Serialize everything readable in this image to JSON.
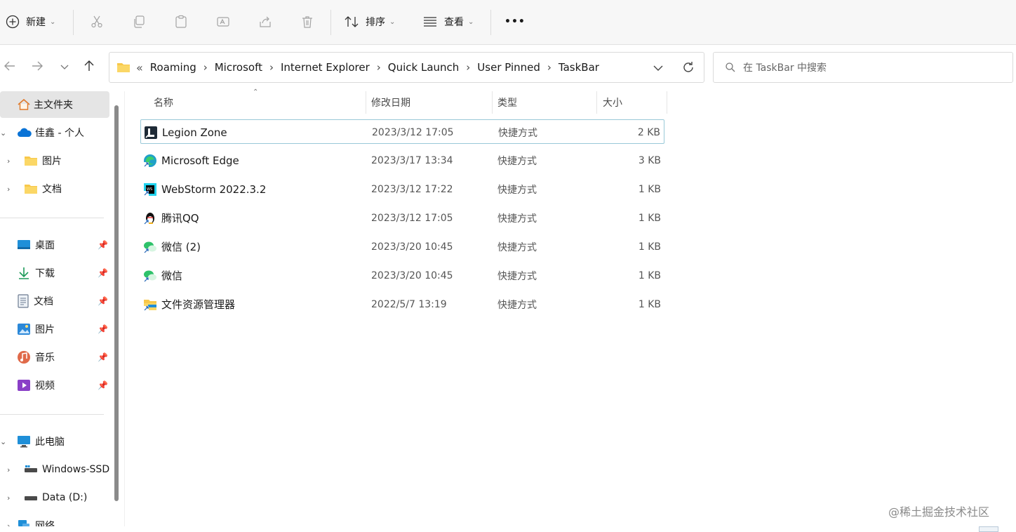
{
  "toolbar": {
    "new_label": "新建",
    "sort_label": "排序",
    "view_label": "查看",
    "more_label": "•••"
  },
  "address": {
    "overflow": "«",
    "crumbs": [
      "Roaming",
      "Microsoft",
      "Internet Explorer",
      "Quick Launch",
      "User Pinned",
      "TaskBar"
    ]
  },
  "search": {
    "placeholder": "在 TaskBar 中搜索"
  },
  "sidebar": {
    "home": "主文件夹",
    "onedrive": "佳鑫 - 个人",
    "od_pictures": "图片",
    "od_docs": "文档",
    "quick": [
      {
        "label": "桌面"
      },
      {
        "label": "下载"
      },
      {
        "label": "文档"
      },
      {
        "label": "图片"
      },
      {
        "label": "音乐"
      },
      {
        "label": "视频"
      }
    ],
    "thispc": "此电脑",
    "drive_c": "Windows-SSD",
    "drive_d": "Data (D:)",
    "network": "网络"
  },
  "columns": {
    "name": "名称",
    "date": "修改日期",
    "type": "类型",
    "size": "大小"
  },
  "files": [
    {
      "name": "Legion Zone",
      "date": "2023/3/12 17:05",
      "type": "快捷方式",
      "size": "2 KB"
    },
    {
      "name": "Microsoft Edge",
      "date": "2023/3/17 13:34",
      "type": "快捷方式",
      "size": "3 KB"
    },
    {
      "name": "WebStorm 2022.3.2",
      "date": "2023/3/12 17:22",
      "type": "快捷方式",
      "size": "1 KB"
    },
    {
      "name": "腾讯QQ",
      "date": "2023/3/12 17:05",
      "type": "快捷方式",
      "size": "1 KB"
    },
    {
      "name": "微信 (2)",
      "date": "2023/3/20 10:45",
      "type": "快捷方式",
      "size": "1 KB"
    },
    {
      "name": "微信",
      "date": "2023/3/20 10:45",
      "type": "快捷方式",
      "size": "1 KB"
    },
    {
      "name": "文件资源管理器",
      "date": "2022/5/7 13:19",
      "type": "快捷方式",
      "size": "1 KB"
    }
  ],
  "watermark": "@稀土掘金技术社区",
  "colors": {
    "accent": "#0067c0",
    "selection_border": "#99c9d8",
    "folder": "#f8c84a"
  }
}
